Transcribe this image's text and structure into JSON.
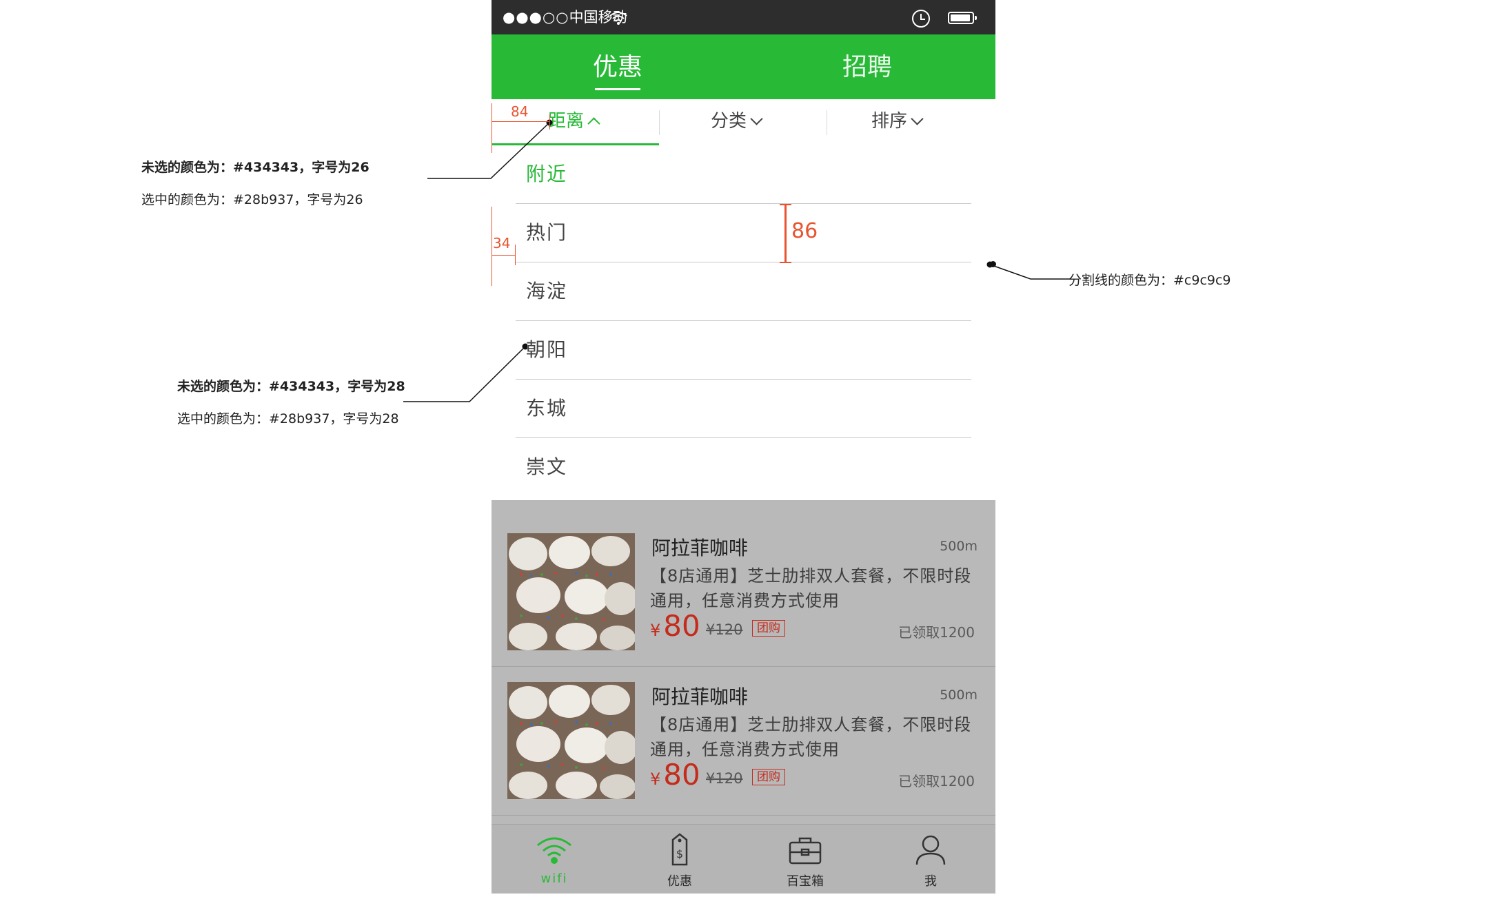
{
  "status_bar": {
    "signal": "●●●○○",
    "carrier": "中国移动"
  },
  "top_tabs": [
    {
      "label": "优惠"
    },
    {
      "label": "招聘"
    }
  ],
  "filters": [
    {
      "label": "距离"
    },
    {
      "label": "分类"
    },
    {
      "label": "排序"
    }
  ],
  "dropdown_items": [
    {
      "label": "附近",
      "selected": true
    },
    {
      "label": "热门"
    },
    {
      "label": "海淀"
    },
    {
      "label": "朝阳"
    },
    {
      "label": "东城"
    },
    {
      "label": "崇文"
    }
  ],
  "cards": [
    {
      "title": "阿拉菲咖啡",
      "distance": "500m",
      "desc": "【8店通用】芝士肋排双人套餐，不限时段通用，任意消费方式使用",
      "currency": "¥",
      "price": "80",
      "original_price": "¥120",
      "badge": "团购",
      "claimed": "已领取1200"
    },
    {
      "title": "阿拉菲咖啡",
      "distance": "500m",
      "desc": "【8店通用】芝士肋排双人套餐，不限时段通用，任意消费方式使用",
      "currency": "¥",
      "price": "80",
      "original_price": "¥120",
      "badge": "团购",
      "claimed": "已领取1200"
    }
  ],
  "tabbar": [
    {
      "label": "wifi",
      "icon": "wifi-icon",
      "active": true
    },
    {
      "label": "优惠",
      "icon": "price-tag-icon"
    },
    {
      "label": "百宝箱",
      "icon": "toolbox-icon"
    },
    {
      "label": "我",
      "icon": "user-icon"
    }
  ],
  "annotations": {
    "filter_note_1": "未选的颜色为：#434343，字号为26",
    "filter_note_2": "选中的颜色为：#28b937，字号为26",
    "item_note_1": "未选的颜色为：#434343，字号为28",
    "item_note_2": "选中的颜色为：#28b937，字号为28",
    "divider_note": "分割线的颜色为：#c9c9c9",
    "dim_84": "84",
    "dim_34": "34",
    "dim_86": "86"
  },
  "colors": {
    "brand_green": "#28b937",
    "text": "#434343",
    "divider": "#c9c9c9",
    "annotation_red": "#e8542f",
    "price_red": "#c42b1c"
  }
}
